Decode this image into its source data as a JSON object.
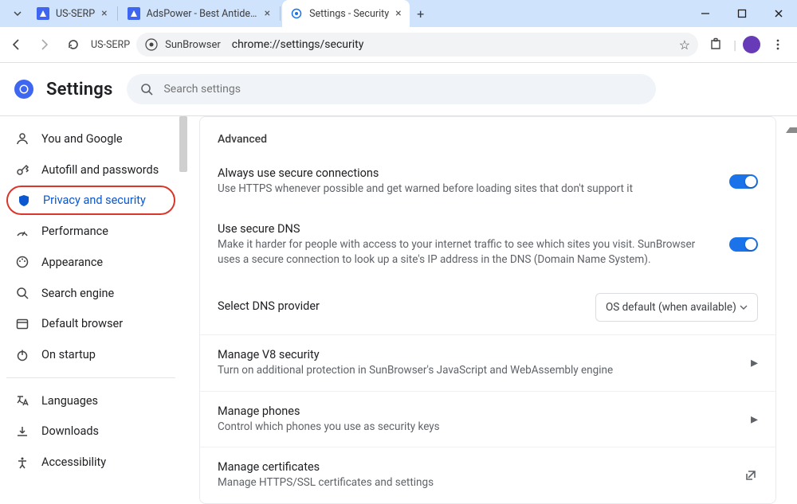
{
  "tabs": [
    {
      "title": "US-SERP"
    },
    {
      "title": "AdsPower - Best Antidetect B"
    },
    {
      "title": "Settings - Security"
    }
  ],
  "toolbar": {
    "profile_label": "US-SERP",
    "site_text": "SunBrowser",
    "url": "chrome://settings/security"
  },
  "page_title": "Settings",
  "search": {
    "placeholder": "Search settings"
  },
  "sidebar": {
    "items": [
      {
        "label": "You and Google"
      },
      {
        "label": "Autofill and passwords"
      },
      {
        "label": "Privacy and security"
      },
      {
        "label": "Performance"
      },
      {
        "label": "Appearance"
      },
      {
        "label": "Search engine"
      },
      {
        "label": "Default browser"
      },
      {
        "label": "On startup"
      }
    ],
    "secondary": [
      {
        "label": "Languages"
      },
      {
        "label": "Downloads"
      },
      {
        "label": "Accessibility"
      }
    ]
  },
  "content": {
    "section_title": "Advanced",
    "rows": {
      "secure_conn": {
        "title": "Always use secure connections",
        "sub": "Use HTTPS whenever possible and get warned before loading sites that don't support it"
      },
      "secure_dns": {
        "title": "Use secure DNS",
        "sub": "Make it harder for people with access to your internet traffic to see which sites you visit. SunBrowser uses a secure connection to look up a site's IP address in the DNS (Domain Name System)."
      },
      "dns_provider": {
        "title": "Select DNS provider",
        "selected": "OS default (when available)"
      },
      "v8": {
        "title": "Manage V8 security",
        "sub": "Turn on additional protection in SunBrowser's JavaScript and WebAssembly engine"
      },
      "phones": {
        "title": "Manage phones",
        "sub": "Control which phones you use as security keys"
      },
      "certs": {
        "title": "Manage certificates",
        "sub": "Manage HTTPS/SSL certificates and settings"
      }
    }
  }
}
